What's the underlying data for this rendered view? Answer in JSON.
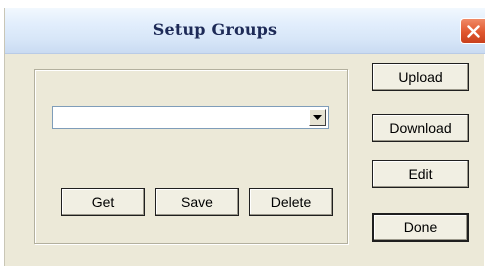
{
  "window": {
    "title": "Setup Groups"
  },
  "group": {
    "combo_value": ""
  },
  "buttons": {
    "get": "Get",
    "save": "Save",
    "delete": "Delete",
    "upload": "Upload",
    "download": "Download",
    "edit": "Edit",
    "done": "Done"
  },
  "icons": {
    "close": "close-icon",
    "dropdown": "chevron-down-icon"
  },
  "colors": {
    "dialog_bg": "#ece9d8",
    "title_text": "#1d2a57",
    "close_button": "#e0572f"
  }
}
